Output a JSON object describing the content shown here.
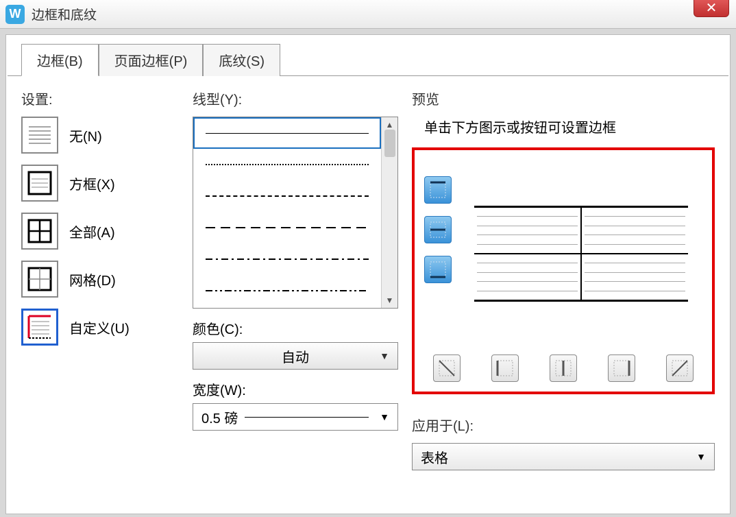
{
  "titlebar": {
    "title": "边框和底纹"
  },
  "tabs": {
    "border": "边框(B)",
    "page_border": "页面边框(P)",
    "shading": "底纹(S)"
  },
  "settings": {
    "label": "设置:",
    "none": "无(N)",
    "box": "方框(X)",
    "all": "全部(A)",
    "grid": "网格(D)",
    "custom": "自定义(U)"
  },
  "style": {
    "line_label": "线型(Y):",
    "color_label": "颜色(C):",
    "color_value": "自动",
    "width_label": "宽度(W):",
    "width_value": "0.5 磅"
  },
  "preview": {
    "label": "预览",
    "hint": "单击下方图示或按钮可设置边框"
  },
  "apply": {
    "label": "应用于(L):",
    "value": "表格"
  }
}
